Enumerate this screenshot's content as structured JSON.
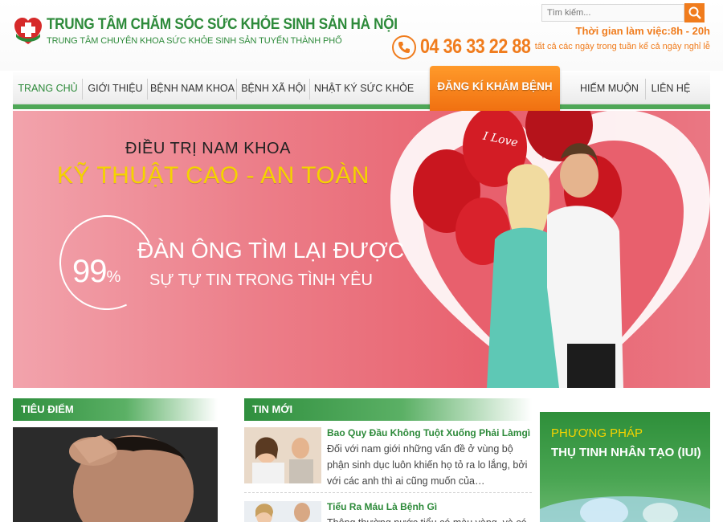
{
  "header": {
    "title": "TRUNG TÂM CHĂM SÓC SỨC KHỎE SINH SẢN HÀ NỘI",
    "subtitle": "TRUNG TÂM CHUYÊN KHOA SỨC KHỎE SINH SẢN TUYẾN THÀNH PHỐ",
    "phone": "04 36 33 22 88",
    "search_placeholder": "Tìm kiếm...",
    "hours": "Thời gian làm việc:8h - 20h",
    "hours_sub": "tất cả các ngày trong tuần kể cả ngày nghỉ lễ"
  },
  "nav": {
    "items": [
      {
        "label": "TRANG CHỦ"
      },
      {
        "label": "GIỚI THIỆU"
      },
      {
        "label": "BỆNH NAM KHOA"
      },
      {
        "label": "BỆNH XÃ HỘI"
      },
      {
        "label": "NHẬT KÝ SỨC KHỎE"
      },
      {
        "label": "HIẾM MUỘN"
      },
      {
        "label": "LIÊN HỆ"
      }
    ],
    "cta": "ĐĂNG KÍ KHÁM BỆNH"
  },
  "banner": {
    "line1": "ĐIỀU TRỊ NAM KHOA",
    "line2": "KỸ THUẬT CAO - AN TOÀN",
    "percent": "99",
    "percent_sign": "%",
    "line3": "ĐÀN ÔNG TÌM LẠI ĐƯỢC",
    "line4": "SỰ TỰ TIN TRONG TÌNH YÊU",
    "balloon_text": "I Love"
  },
  "sections": {
    "focus": "TIÊU ĐIỂM",
    "news": "TIN MỚI"
  },
  "news": [
    {
      "title": "Bao Quy Đầu Không Tuột Xuống Phải Làmgì",
      "text": "Đối với nam giới những vấn đề ở vùng bộ phận sinh dục luôn khiến họ tỏ ra lo lắng, bởi với các anh thì ai cũng muốn của…"
    },
    {
      "title": "Tiểu Ra Máu Là Bệnh Gì",
      "text": "Thông thường nước tiểu có màu vàng, và có thể"
    }
  ],
  "ad": {
    "line1": "PHƯƠNG PHÁP",
    "line2": "THỤ TINH NHÂN TẠO (IUI)"
  },
  "colors": {
    "brand_green": "#2d8a3a",
    "accent_orange": "#f07c1d",
    "banner_pink": "#e8606d",
    "banner_yellow": "#f5d300"
  },
  "icons": [
    "logo-cross-icon",
    "phone-icon",
    "search-icon"
  ]
}
